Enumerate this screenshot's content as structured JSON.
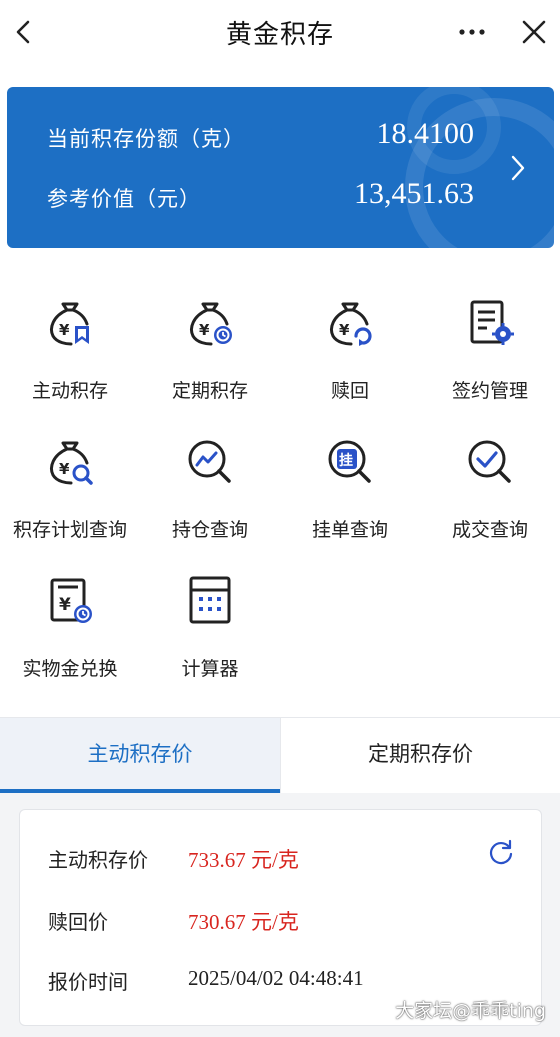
{
  "header": {
    "title": "黄金积存"
  },
  "summary": {
    "share_label": "当前积存份额（克）",
    "share_value": "18.4100",
    "value_label": "参考价值（元）",
    "value_amount": "13,451.63"
  },
  "grid": [
    {
      "label": "主动积存",
      "icon": "money-bag-bookmark-icon"
    },
    {
      "label": "定期积存",
      "icon": "money-bag-clock-icon"
    },
    {
      "label": "赎回",
      "icon": "money-bag-redeem-icon"
    },
    {
      "label": "签约管理",
      "icon": "document-gear-icon"
    },
    {
      "label": "积存计划查询",
      "icon": "money-bag-search-icon"
    },
    {
      "label": "持仓查询",
      "icon": "trend-search-icon"
    },
    {
      "label": "挂单查询",
      "icon": "order-search-icon"
    },
    {
      "label": "成交查询",
      "icon": "check-search-icon"
    },
    {
      "label": "实物金兑换",
      "icon": "gold-exchange-icon"
    },
    {
      "label": "计算器",
      "icon": "calculator-icon"
    }
  ],
  "tabs": {
    "active": "主动积存价",
    "inactive": "定期积存价"
  },
  "price": {
    "buy_label": "主动积存价",
    "buy_value": "733.67 元/克",
    "redeem_label": "赎回价",
    "redeem_value": "730.67 元/克",
    "time_label": "报价时间",
    "time_value": "2025/04/02 04:48:41"
  },
  "watermark": "大家坛@乖乖ting",
  "colors": {
    "primary": "#1d6fc4",
    "accent": "#2a52c8",
    "price_red": "#d8251f"
  }
}
